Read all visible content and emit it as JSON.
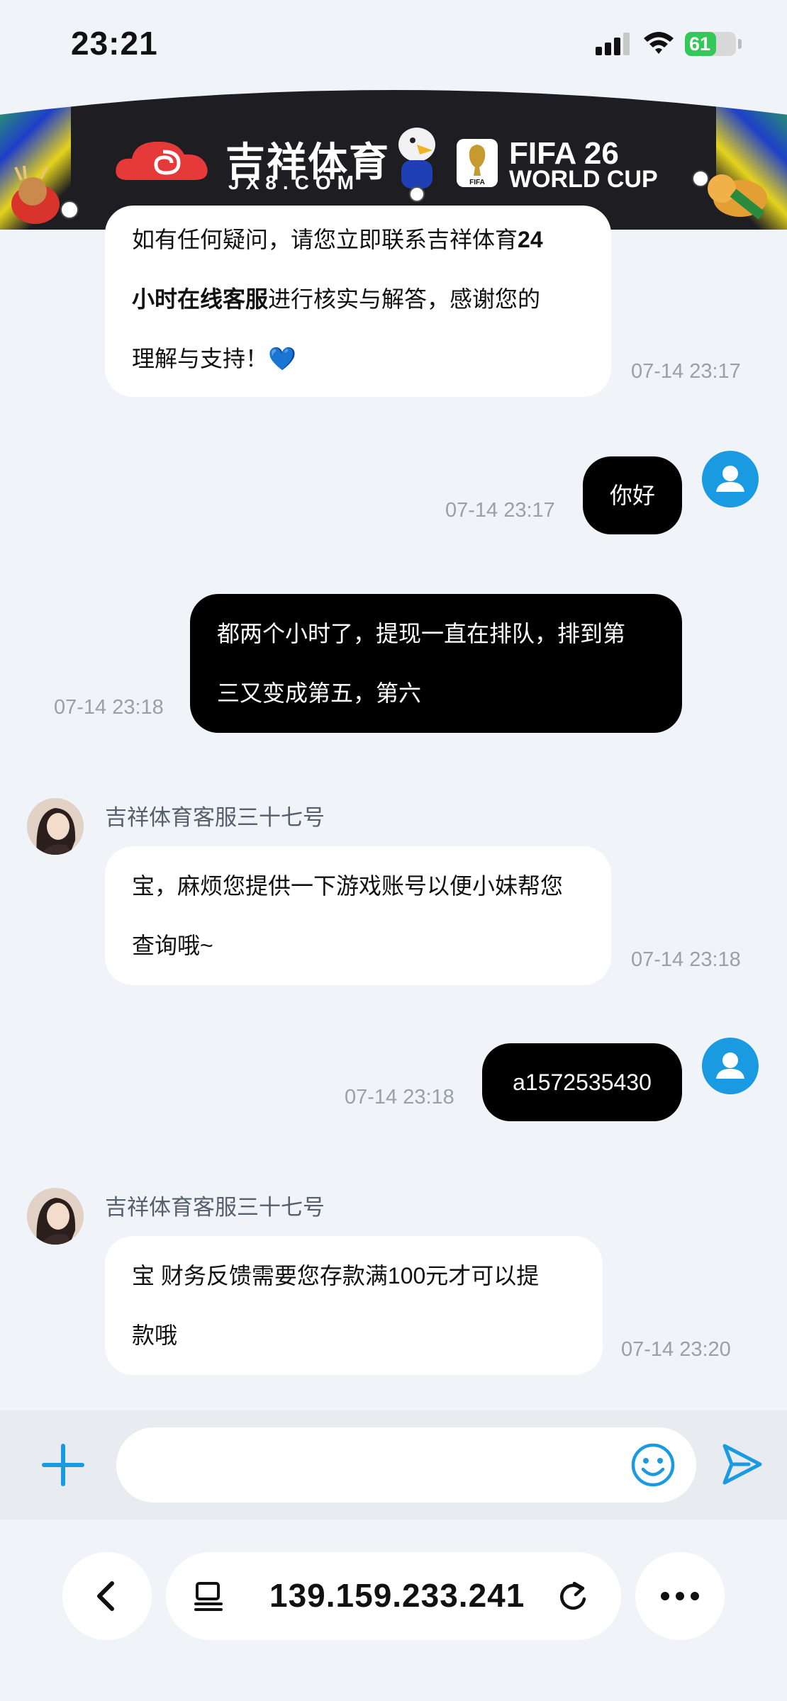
{
  "status_bar": {
    "time": "23:21",
    "battery": "61"
  },
  "banner": {
    "brand_cn": "吉祥体育",
    "brand_en": "JX8.COM",
    "fifa_line1": "FIFA 26",
    "fifa_line2": "WORLD CUP",
    "trophy_label": "FIFA"
  },
  "messages": [
    {
      "sender": "agent",
      "lines": [
        {
          "segments": [
            {
              "text": "如有任何疑问，请您立即联系吉祥体育"
            },
            {
              "text": "24",
              "bold": true
            }
          ]
        },
        {
          "segments": [
            {
              "text": "小时在线客服",
              "bold": true
            },
            {
              "text": "进行核实与解答，感谢您的"
            }
          ]
        },
        {
          "segments": [
            {
              "text": "理解与支持！💙"
            }
          ]
        }
      ],
      "time": "07-14 23:17"
    },
    {
      "sender": "user",
      "lines": [
        {
          "segments": [
            {
              "text": "你好"
            }
          ]
        }
      ],
      "time": "07-14 23:17"
    },
    {
      "sender": "user",
      "lines": [
        {
          "segments": [
            {
              "text": "都两个小时了，提现一直在排队，排到第"
            }
          ]
        },
        {
          "segments": [
            {
              "text": "三又变成第五，第六"
            }
          ]
        }
      ],
      "time": "07-14 23:18"
    },
    {
      "sender": "agent",
      "name": "吉祥体育客服三十七号",
      "lines": [
        {
          "segments": [
            {
              "text": "宝，麻烦您提供一下游戏账号以便小妹帮您"
            }
          ]
        },
        {
          "segments": [
            {
              "text": "查询哦~"
            }
          ]
        }
      ],
      "time": "07-14 23:18"
    },
    {
      "sender": "user",
      "lines": [
        {
          "segments": [
            {
              "text": "a1572535430"
            }
          ]
        }
      ],
      "time": "07-14 23:18"
    },
    {
      "sender": "agent",
      "name": "吉祥体育客服三十七号",
      "lines": [
        {
          "segments": [
            {
              "text": "宝 财务反馈需要您存款满100元才可以提"
            }
          ]
        },
        {
          "segments": [
            {
              "text": "款哦"
            }
          ]
        }
      ],
      "time": "07-14 23:20"
    }
  ],
  "input": {
    "placeholder": ""
  },
  "browser": {
    "url": "139.159.233.241"
  },
  "colors": {
    "accent": "#1a9ae0",
    "user_bubble": "#000000",
    "agent_bubble": "#ffffff",
    "battery": "#34c759"
  },
  "icons": [
    "plus-icon",
    "emoji-icon",
    "send-icon",
    "back-icon",
    "tabs-icon",
    "reload-icon",
    "more-icon"
  ]
}
